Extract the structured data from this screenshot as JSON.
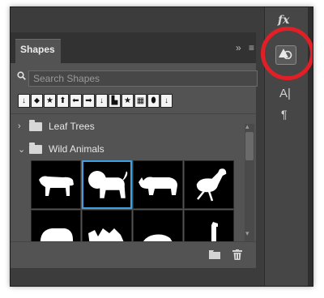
{
  "panel": {
    "tab_label": "Shapes",
    "collapse_glyph": "»",
    "menu_glyph": "≡",
    "search_placeholder": "Search Shapes",
    "legacy_icons": [
      "↓",
      "⬥",
      "★",
      "⬆",
      "⬅",
      "➡",
      "↓",
      "▙",
      "★",
      "▦",
      "⬮",
      "↓"
    ],
    "groups": [
      {
        "label": "Leaf Trees",
        "expanded": false,
        "chevron": "›"
      },
      {
        "label": "Wild Animals",
        "expanded": true,
        "chevron": "⌄"
      }
    ],
    "shapes": [
      "lioness",
      "lion",
      "rhino",
      "ostrich",
      "elephant",
      "camel",
      "bear",
      "giraffe"
    ],
    "selected_shape": "lion"
  },
  "right_strip": {
    "fx_label": "fx",
    "shapes_tool_icon": "shapes-panel-icon",
    "text_tool_glyph": "A|",
    "paragraph_glyph": "¶"
  },
  "footer": {
    "new_folder_icon": "folder-icon",
    "delete_icon": "trash-icon"
  },
  "colors": {
    "highlight": "#e11f26",
    "selection": "#3ea0e0"
  }
}
